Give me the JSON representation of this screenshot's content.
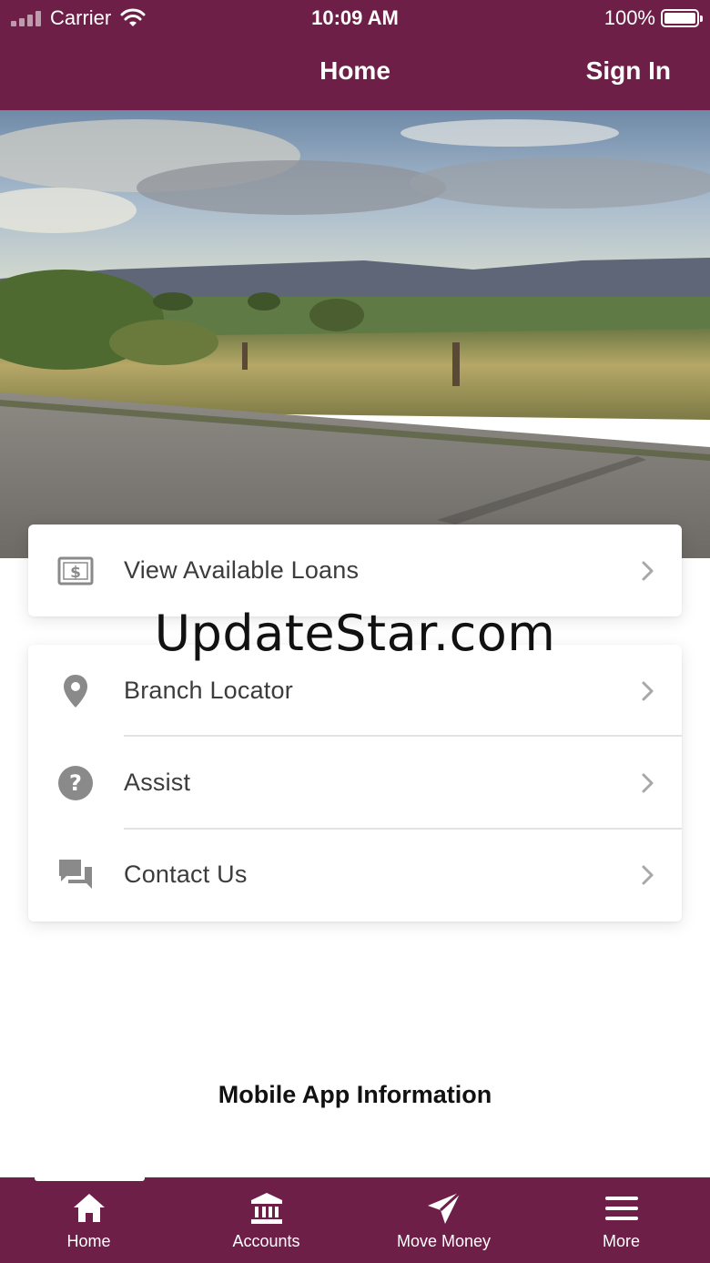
{
  "status_bar": {
    "carrier": "Carrier",
    "time": "10:09 AM",
    "battery": "100%"
  },
  "header": {
    "title": "Home",
    "sign_in": "Sign In",
    "bg_color": "#6e1f47"
  },
  "menu": {
    "loans": {
      "label": "View Available Loans",
      "icon": "dollar-bill-icon"
    },
    "items": [
      {
        "label": "Branch Locator",
        "icon": "location-pin-icon"
      },
      {
        "label": "Assist",
        "icon": "question-circle-icon"
      },
      {
        "label": "Contact Us",
        "icon": "chat-bubbles-icon"
      }
    ]
  },
  "watermark": "UpdateStar.com",
  "info_title": "Mobile App Information",
  "tabbar": {
    "tabs": [
      {
        "label": "Home",
        "icon": "home-icon",
        "active": true
      },
      {
        "label": "Accounts",
        "icon": "bank-icon"
      },
      {
        "label": "Move Money",
        "icon": "paper-plane-icon"
      },
      {
        "label": "More",
        "icon": "menu-icon"
      }
    ]
  }
}
